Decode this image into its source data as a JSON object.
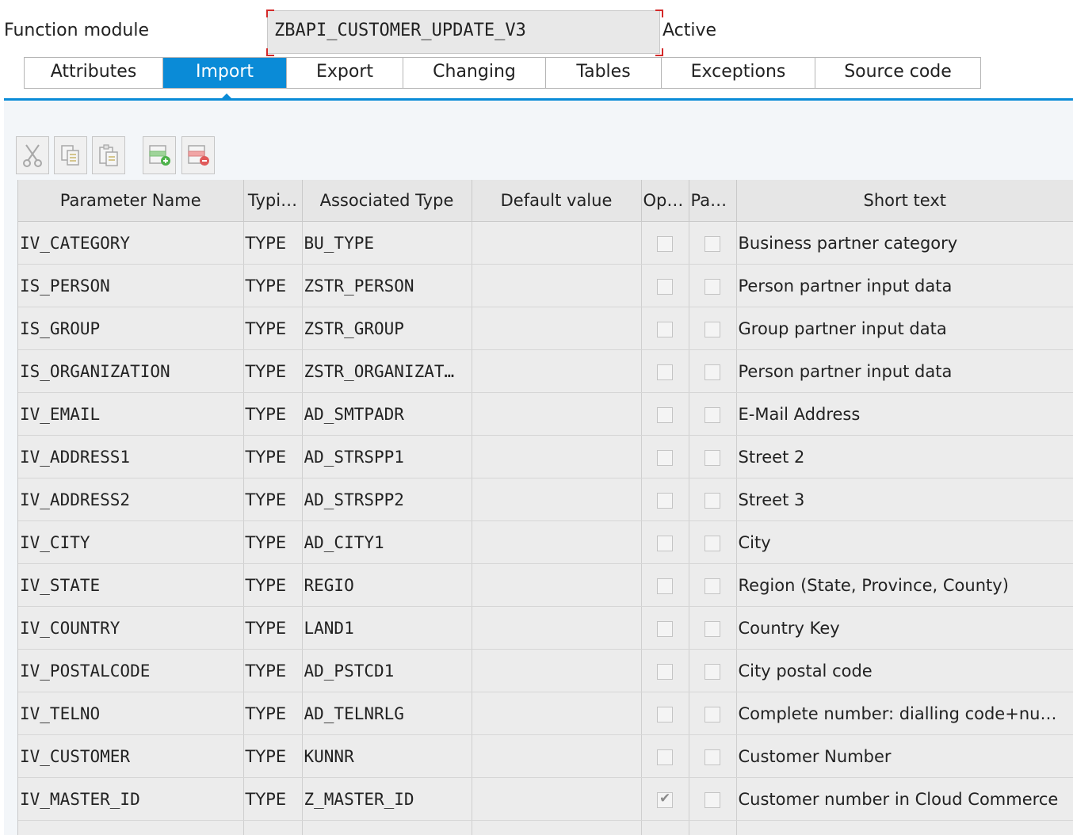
{
  "function_module": {
    "label": "Function module",
    "name": "ZBAPI_CUSTOMER_UPDATE_V3",
    "status": "Active"
  },
  "tabs": [
    {
      "label": "Attributes"
    },
    {
      "label": "Import"
    },
    {
      "label": "Export"
    },
    {
      "label": "Changing"
    },
    {
      "label": "Tables"
    },
    {
      "label": "Exceptions"
    },
    {
      "label": "Source code"
    }
  ],
  "active_tab": "Import",
  "toolbar": {
    "buttons": [
      "cut-icon",
      "copy-icon",
      "paste-icon",
      "insert-row-icon",
      "delete-row-icon"
    ]
  },
  "colors": {
    "accent": "#0a8bd7",
    "highlight_corner": "#d42a2a"
  },
  "grid": {
    "columns": [
      "Parameter Name",
      "Typi…",
      "Associated Type",
      "Default value",
      "Opt…",
      "Pas…",
      "Short text"
    ],
    "rows": [
      {
        "name": "IV_CATEGORY",
        "typing": "TYPE",
        "type": "BU_TYPE",
        "default": "",
        "optional": false,
        "pass_value": false,
        "short_text": "Business partner category"
      },
      {
        "name": "IS_PERSON",
        "typing": "TYPE",
        "type": "ZSTR_PERSON",
        "default": "",
        "optional": false,
        "pass_value": false,
        "short_text": "Person partner input data"
      },
      {
        "name": "IS_GROUP",
        "typing": "TYPE",
        "type": "ZSTR_GROUP",
        "default": "",
        "optional": false,
        "pass_value": false,
        "short_text": "Group partner input data"
      },
      {
        "name": "IS_ORGANIZATION",
        "typing": "TYPE",
        "type": "ZSTR_ORGANIZAT…",
        "default": "",
        "optional": false,
        "pass_value": false,
        "short_text": "Person partner input data"
      },
      {
        "name": "IV_EMAIL",
        "typing": "TYPE",
        "type": "AD_SMTPADR",
        "default": "",
        "optional": false,
        "pass_value": false,
        "short_text": "E-Mail Address"
      },
      {
        "name": "IV_ADDRESS1",
        "typing": "TYPE",
        "type": "AD_STRSPP1",
        "default": "",
        "optional": false,
        "pass_value": false,
        "short_text": "Street 2"
      },
      {
        "name": "IV_ADDRESS2",
        "typing": "TYPE",
        "type": "AD_STRSPP2",
        "default": "",
        "optional": false,
        "pass_value": false,
        "short_text": "Street 3"
      },
      {
        "name": "IV_CITY",
        "typing": "TYPE",
        "type": "AD_CITY1",
        "default": "",
        "optional": false,
        "pass_value": false,
        "short_text": "City"
      },
      {
        "name": "IV_STATE",
        "typing": "TYPE",
        "type": "REGIO",
        "default": "",
        "optional": false,
        "pass_value": false,
        "short_text": "Region (State, Province, County)"
      },
      {
        "name": "IV_COUNTRY",
        "typing": "TYPE",
        "type": "LAND1",
        "default": "",
        "optional": false,
        "pass_value": false,
        "short_text": "Country Key"
      },
      {
        "name": "IV_POSTALCODE",
        "typing": "TYPE",
        "type": "AD_PSTCD1",
        "default": "",
        "optional": false,
        "pass_value": false,
        "short_text": "City postal code"
      },
      {
        "name": "IV_TELNO",
        "typing": "TYPE",
        "type": "AD_TELNRLG",
        "default": "",
        "optional": false,
        "pass_value": false,
        "short_text": "Complete number: dialling code+num…"
      },
      {
        "name": "IV_CUSTOMER",
        "typing": "TYPE",
        "type": "KUNNR",
        "default": "",
        "optional": false,
        "pass_value": false,
        "short_text": "Customer Number"
      },
      {
        "name": "IV_MASTER_ID",
        "typing": "TYPE",
        "type": "Z_MASTER_ID",
        "default": "",
        "optional": true,
        "pass_value": false,
        "short_text": "Customer number in Cloud Commerce"
      },
      {
        "name": "",
        "typing": "",
        "type": "",
        "default": "",
        "optional": false,
        "pass_value": false,
        "short_text": ""
      }
    ]
  }
}
